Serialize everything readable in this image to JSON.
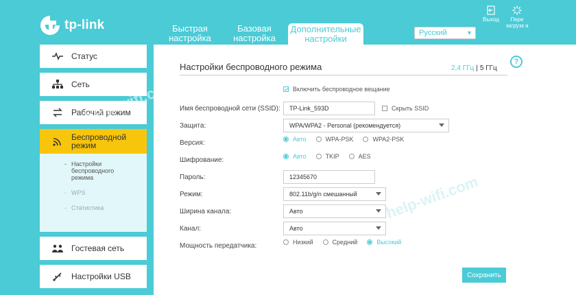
{
  "logo": {
    "text": "tp-link"
  },
  "tabs": [
    {
      "label": "Быстрая настройка"
    },
    {
      "label": "Базовая настройка"
    },
    {
      "label": "Дополнительные настройки"
    }
  ],
  "language": {
    "selected": "Русский"
  },
  "top_actions": {
    "logout": "Выход",
    "reboot": "Пере загрузк а"
  },
  "sidebar": {
    "items": [
      {
        "label": "Статус",
        "icon": "pulse-icon"
      },
      {
        "label": "Сеть",
        "icon": "network-icon"
      },
      {
        "label": "Рабочий режим",
        "icon": "switch-mode-icon"
      },
      {
        "label": "Беспроводной режим",
        "icon": "wifi-icon"
      },
      {
        "label": "Гостевая сеть",
        "icon": "guest-users-icon"
      },
      {
        "label": "Настройки USB",
        "icon": "usb-icon"
      }
    ],
    "subitems": [
      {
        "label": "Настройки беспроводного режима"
      },
      {
        "label": "WPS"
      },
      {
        "label": "Статистика"
      }
    ]
  },
  "main": {
    "heading": "Настройки беспроводного режима",
    "band_24": "2,4 ГГц",
    "band_sep": "|",
    "band_5": "5 ГГц",
    "enable_broadcast": "Включить беспроводное вещание",
    "ssid_label": "Имя беспроводной сети (SSID):",
    "ssid_value": "TP-Link_593D",
    "hide_ssid": "Скрыть SSID",
    "security_label": "Защита:",
    "security_value": "WPA/WPA2 - Personal (рекомендуется)",
    "version_label": "Версия:",
    "version_options": [
      "Авто",
      "WPA-PSK",
      "WPA2-PSK"
    ],
    "encryption_label": "Шифрование:",
    "encryption_options": [
      "Авто",
      "TKIP",
      "AES"
    ],
    "password_label": "Пароль:",
    "password_value": "12345670",
    "mode_label": "Режим:",
    "mode_value": "802.11b/g/n смешанный",
    "width_label": "Ширина канала:",
    "width_value": "Авто",
    "channel_label": "Канал:",
    "channel_value": "Авто",
    "power_label": "Мощность передатчика:",
    "power_options": [
      "Низкий",
      "Средний",
      "Высокий"
    ],
    "save": "Сохранить"
  },
  "watermark": "help-wifi.com",
  "colors": {
    "accent": "#4acbd6",
    "active_menu": "#f7c50b"
  }
}
